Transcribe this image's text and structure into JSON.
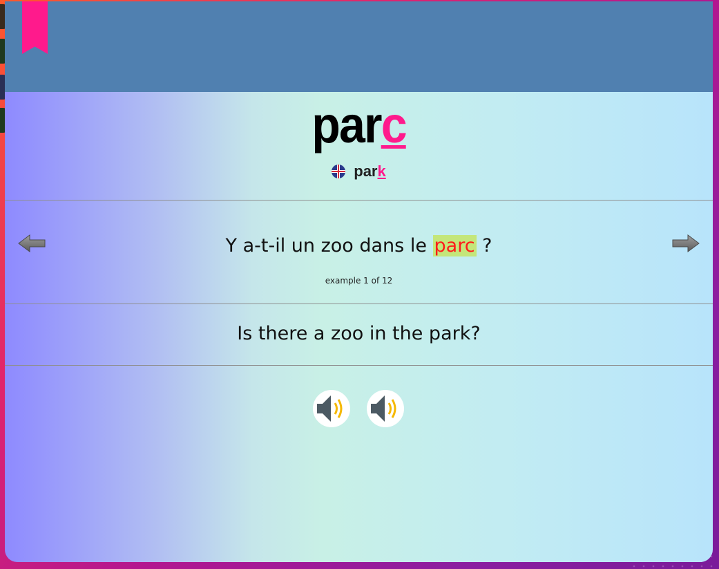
{
  "word": {
    "base": "par",
    "highlight": "c"
  },
  "translation": {
    "flag_icon": "uk-flag-icon",
    "base": "par",
    "highlight": "k"
  },
  "example": {
    "before": "Y a-t-il un zoo dans le ",
    "highlight": "parc",
    "after": " ?",
    "counter": "example 1 of 12"
  },
  "english_sentence": "Is there a zoo in the park?",
  "navigation": {
    "prev_icon": "arrow-left-icon",
    "next_icon": "arrow-right-icon"
  },
  "audio": [
    {
      "icon": "speaker-icon"
    },
    {
      "icon": "speaker-icon"
    }
  ],
  "colors": {
    "accent": "#ff1a8c",
    "header": "#5080b0",
    "highlight_bg": "#c4e67a",
    "highlight_text": "#ff1a1a"
  }
}
